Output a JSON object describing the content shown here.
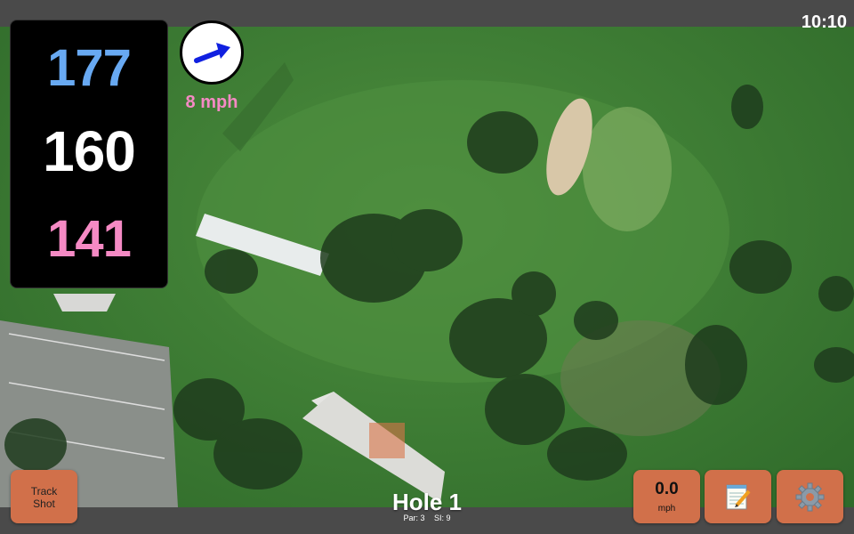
{
  "status_bar": {
    "time": "10:10"
  },
  "distances": {
    "back": "177",
    "middle": "160",
    "front": "141"
  },
  "wind": {
    "speed": "8 mph",
    "direction_icon": "arrow-up-right-icon"
  },
  "hole": {
    "title": "Hole 1",
    "par": "Par: 3",
    "si": "SI: 9"
  },
  "buttons": {
    "track_shot": "Track Shot",
    "speed_value": "0.0",
    "speed_unit": "mph",
    "notes_icon": "notepad-icon",
    "settings_icon": "gear-icon"
  },
  "colors": {
    "back_distance": "#68a9f2",
    "middle_distance": "#ffffff",
    "front_distance": "#f58ac4",
    "button": "#d1704a",
    "bar": "#4a4a4a"
  }
}
